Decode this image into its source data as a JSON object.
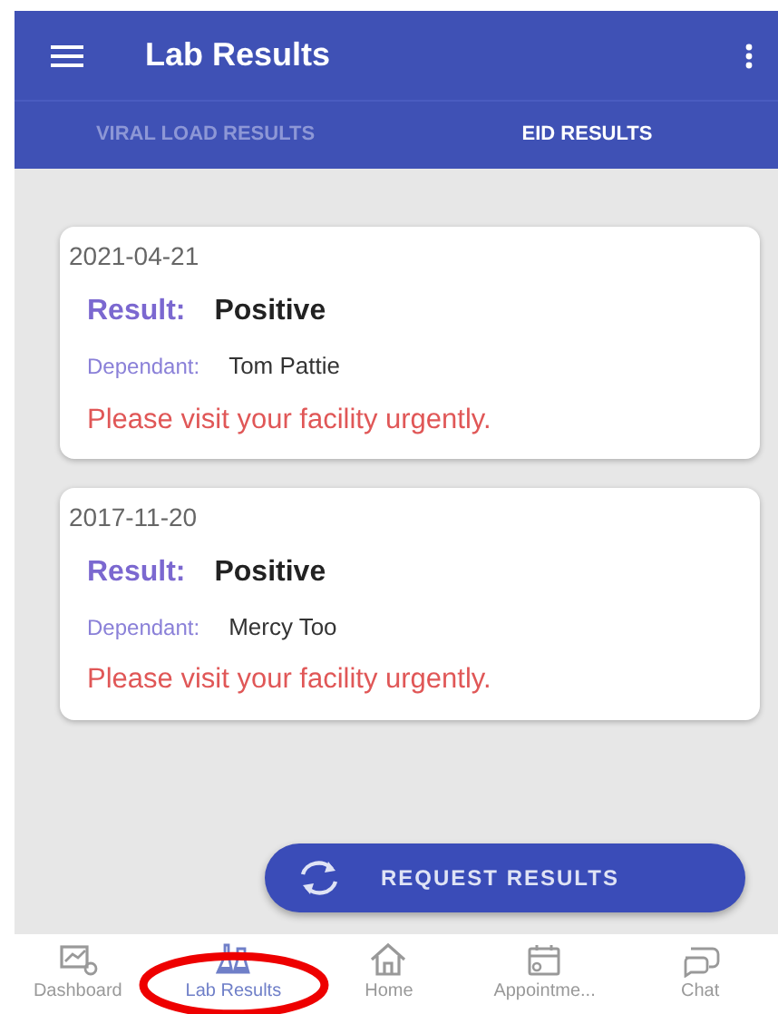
{
  "app_bar": {
    "title": "Lab Results"
  },
  "tabs": [
    {
      "label": "VIRAL LOAD RESULTS",
      "selected": false
    },
    {
      "label": "EID RESULTS",
      "selected": true
    }
  ],
  "results": [
    {
      "date": "2021-04-21",
      "result_label": "Result:",
      "result": "Positive",
      "dependant_label": "Dependant:",
      "dependant": "Tom Pattie",
      "message": "Please visit your facility urgently."
    },
    {
      "date": "2017-11-20",
      "result_label": "Result:",
      "result": "Positive",
      "dependant_label": "Dependant:",
      "dependant": "Mercy Too",
      "message": "Please visit your facility urgently."
    }
  ],
  "request_button": {
    "label": "REQUEST RESULTS"
  },
  "bottom_nav": [
    {
      "kind": "dashboard",
      "label": "Dashboard",
      "selected": false
    },
    {
      "kind": "lab",
      "label": "Lab Results",
      "selected": true,
      "circled": true
    },
    {
      "kind": "home",
      "label": "Home",
      "selected": false
    },
    {
      "kind": "calendar",
      "label": "Appointme...",
      "selected": false
    },
    {
      "kind": "chat",
      "label": "Chat",
      "selected": false
    }
  ]
}
